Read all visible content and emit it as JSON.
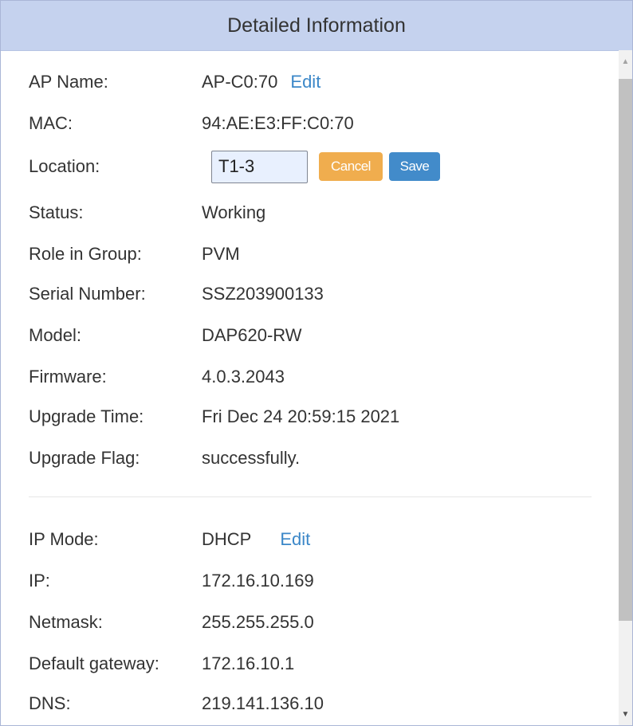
{
  "panel": {
    "title": "Detailed Information"
  },
  "basic": {
    "ap_name": {
      "label": "AP Name:",
      "value": "AP-C0:70",
      "edit": "Edit"
    },
    "mac": {
      "label": "MAC:",
      "value": "94:AE:E3:FF:C0:70"
    },
    "location": {
      "label": "Location:",
      "value": "T1-3",
      "cancel": "Cancel",
      "save": "Save"
    },
    "status": {
      "label": "Status:",
      "value": "Working"
    },
    "role": {
      "label": "Role in Group:",
      "value": "PVM"
    },
    "serial": {
      "label": "Serial Number:",
      "value": "SSZ203900133"
    },
    "model": {
      "label": "Model:",
      "value": "DAP620-RW"
    },
    "firmware": {
      "label": "Firmware:",
      "value": "4.0.3.2043"
    },
    "upgrade_time": {
      "label": "Upgrade Time:",
      "value": "Fri Dec 24 20:59:15 2021"
    },
    "upgrade_flag": {
      "label": "Upgrade Flag:",
      "value": "successfully."
    }
  },
  "network": {
    "ip_mode": {
      "label": "IP Mode:",
      "value": "DHCP",
      "edit": "Edit"
    },
    "ip": {
      "label": "IP:",
      "value": "172.16.10.169"
    },
    "netmask": {
      "label": "Netmask:",
      "value": "255.255.255.0"
    },
    "gateway": {
      "label": "Default gateway:",
      "value": "172.16.10.1"
    },
    "dns": {
      "label": "DNS:",
      "value": "219.141.136.10"
    }
  },
  "icons": {
    "scroll_up": "triangle-up",
    "scroll_down": "triangle-down"
  },
  "colors": {
    "header_bg": "#c5d2ee",
    "link": "#3b87c8",
    "cancel": "#f0ad4e",
    "save": "#428bca"
  }
}
